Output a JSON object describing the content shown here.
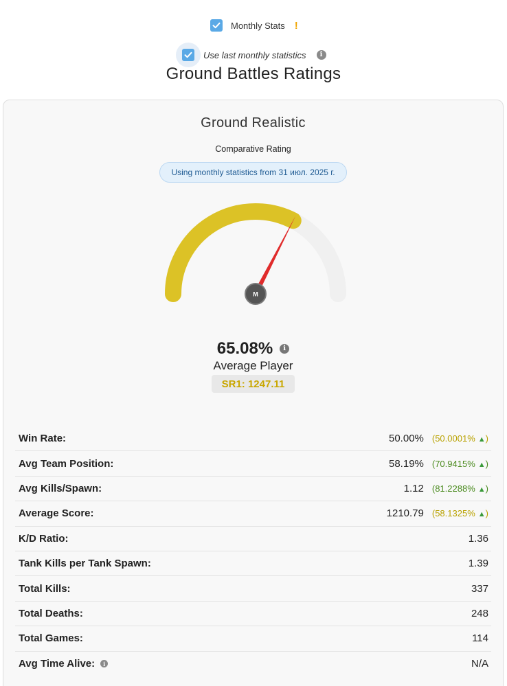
{
  "options": {
    "monthly_stats": {
      "label": "Monthly Stats",
      "checked": true,
      "warn": "!"
    },
    "use_last_monthly": {
      "label": "Use last monthly statistics",
      "checked": true,
      "info": "i"
    }
  },
  "page_title": "Ground Battles Ratings",
  "card": {
    "title": "Ground Realistic",
    "subtitle": "Comparative Rating",
    "notice": "Using monthly statistics from 31 июл. 2025 г.",
    "gauge": {
      "needle_label": "M",
      "fill_fraction": 0.6508,
      "fill_color": "#dcc226",
      "track_color": "#f0f0f0",
      "needle_color": "#e02b2b"
    },
    "score": "65.08%",
    "score_info": "i",
    "tier": "Average Player",
    "sr": "SR1: 1247.11",
    "sr_color": "#c9a700"
  },
  "stats": [
    {
      "name": "Win Rate:",
      "value": "50.00%",
      "pct": "(50.0001%",
      "color": "yellow",
      "arrow": "▲",
      "close": ")"
    },
    {
      "name": "Avg Team Position:",
      "value": "58.19%",
      "pct": "(70.9415%",
      "color": "green",
      "arrow": "▲",
      "close": ")"
    },
    {
      "name": "Avg Kills/Spawn:",
      "value": "1.12",
      "pct": "(81.2288%",
      "color": "green",
      "arrow": "▲",
      "close": ")"
    },
    {
      "name": "Average Score:",
      "value": "1210.79",
      "pct": "(58.1325%",
      "color": "yellow",
      "arrow": "▲",
      "close": ")"
    },
    {
      "name": "K/D Ratio:",
      "value": "1.36"
    },
    {
      "name": "Tank Kills per Tank Spawn:",
      "value": "1.39"
    },
    {
      "name": "Total Kills:",
      "value": "337"
    },
    {
      "name": "Total Deaths:",
      "value": "248"
    },
    {
      "name": "Total Games:",
      "value": "114"
    },
    {
      "name": "Avg Time Alive:",
      "value": "N/A",
      "info": "i"
    }
  ]
}
